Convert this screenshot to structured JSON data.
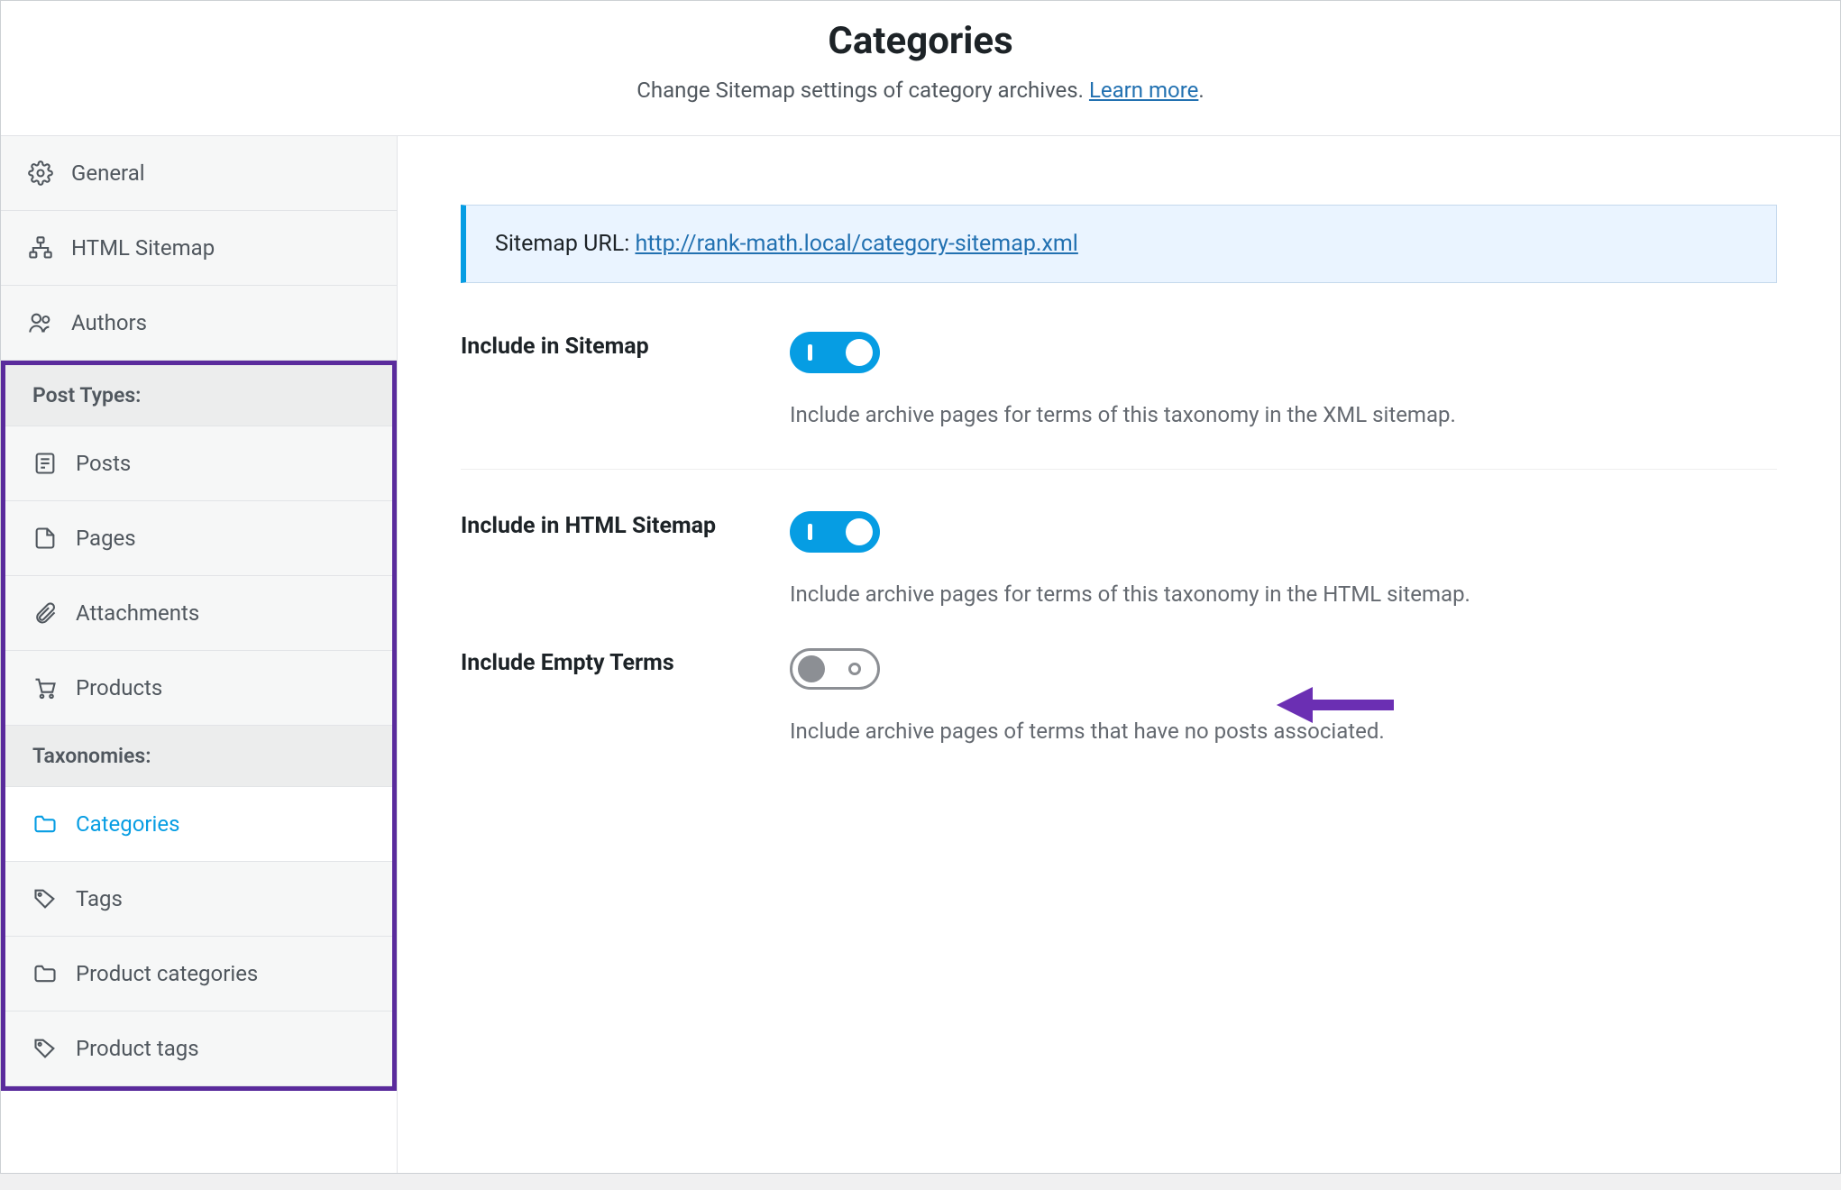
{
  "header": {
    "title": "Categories",
    "subtitle_prefix": "Change Sitemap settings of category archives. ",
    "learn_more": "Learn more",
    "subtitle_suffix": "."
  },
  "sidebar": {
    "top": [
      {
        "label": "General"
      },
      {
        "label": "HTML Sitemap"
      },
      {
        "label": "Authors"
      }
    ],
    "group_post_types": "Post Types:",
    "post_types": [
      {
        "label": "Posts"
      },
      {
        "label": "Pages"
      },
      {
        "label": "Attachments"
      },
      {
        "label": "Products"
      }
    ],
    "group_taxonomies": "Taxonomies:",
    "taxonomies": [
      {
        "label": "Categories",
        "active": true
      },
      {
        "label": "Tags"
      },
      {
        "label": "Product categories"
      },
      {
        "label": "Product tags"
      }
    ]
  },
  "main": {
    "sitemap_url_label": "Sitemap URL: ",
    "sitemap_url_value": "http://rank-math.local/category-sitemap.xml",
    "settings": {
      "include_sitemap": {
        "label": "Include in Sitemap",
        "desc": "Include archive pages for terms of this taxonomy in the XML sitemap.",
        "on": true
      },
      "include_html_sitemap": {
        "label": "Include in HTML Sitemap",
        "desc": "Include archive pages for terms of this taxonomy in the HTML sitemap.",
        "on": true
      },
      "include_empty": {
        "label": "Include Empty Terms",
        "desc": "Include archive pages of terms that have no posts associated.",
        "on": false
      }
    }
  }
}
